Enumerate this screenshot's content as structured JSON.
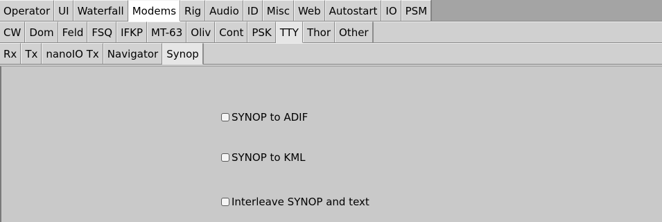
{
  "tabs_row1": [
    "Operator",
    "UI",
    "Waterfall",
    "Modems",
    "Rig",
    "Audio",
    "ID",
    "Misc",
    "Web",
    "Autostart",
    "IO",
    "PSM"
  ],
  "tabs_row1_active": "Modems",
  "tabs_row2": [
    "CW",
    "Dom",
    "Feld",
    "FSQ",
    "IFKP",
    "MT-63",
    "Oliv",
    "Cont",
    "PSK",
    "TTY",
    "Thor",
    "Other"
  ],
  "tabs_row2_active": "TTY",
  "tabs_row3": [
    "Rx",
    "Tx",
    "nanoIO Tx",
    "Navigator",
    "Synop"
  ],
  "tabs_row3_active": "Synop",
  "checkboxes": [
    {
      "label": "SYNOP to ADIF",
      "checked": false
    },
    {
      "label": "SYNOP to KML",
      "checked": false
    },
    {
      "label": "Interleave SYNOP and text",
      "checked": false
    }
  ]
}
